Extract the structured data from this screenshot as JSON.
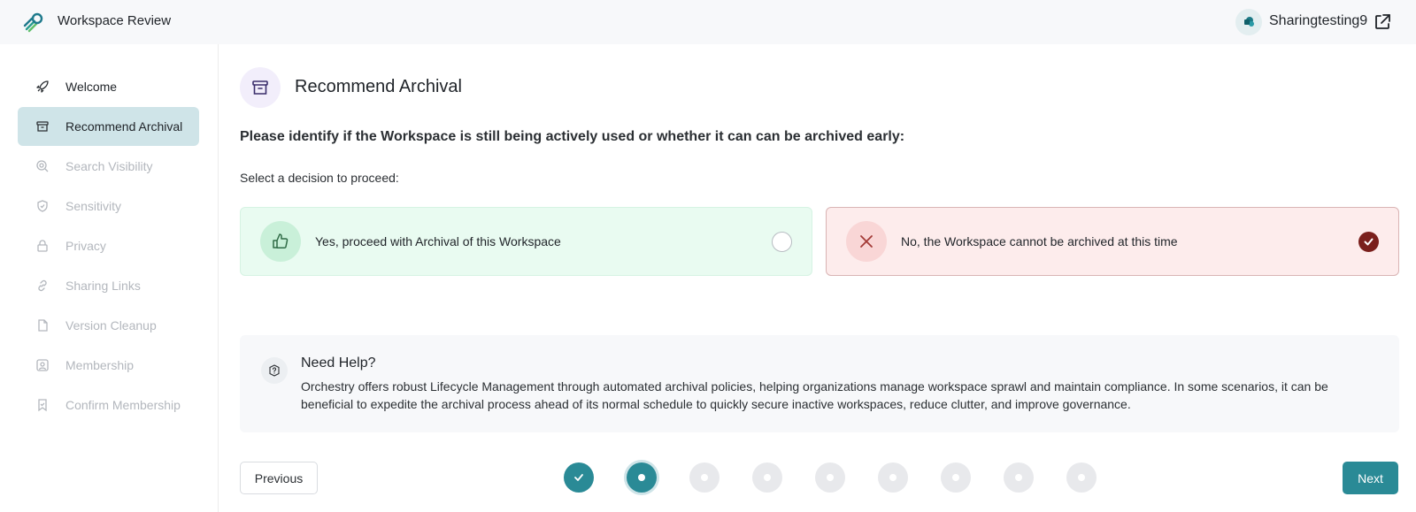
{
  "header": {
    "app_title": "Workspace Review",
    "user_name": "Sharingtesting9"
  },
  "sidebar": {
    "items": [
      {
        "label": "Welcome",
        "icon": "rocket-icon",
        "state": "done"
      },
      {
        "label": "Recommend Archival",
        "icon": "archive-icon",
        "state": "active"
      },
      {
        "label": "Search Visibility",
        "icon": "search-visibility-icon",
        "state": "pending"
      },
      {
        "label": "Sensitivity",
        "icon": "shield-icon",
        "state": "pending"
      },
      {
        "label": "Privacy",
        "icon": "lock-icon",
        "state": "pending"
      },
      {
        "label": "Sharing Links",
        "icon": "link-icon",
        "state": "pending"
      },
      {
        "label": "Version Cleanup",
        "icon": "document-icon",
        "state": "pending"
      },
      {
        "label": "Membership",
        "icon": "person-icon",
        "state": "pending"
      },
      {
        "label": "Confirm Membership",
        "icon": "bookmark-check-icon",
        "state": "pending"
      }
    ]
  },
  "main": {
    "section_title": "Recommend Archival",
    "question": "Please identify if the Workspace is still being actively used or whether it can can be archived early:",
    "select_prompt": "Select a decision to proceed:",
    "options": [
      {
        "label": "Yes, proceed with Archival of this Workspace",
        "icon": "thumbs-up-icon",
        "selected": false,
        "color": "#e9fbf1"
      },
      {
        "label": "No, the Workspace cannot be archived at this time",
        "icon": "x-icon",
        "selected": true,
        "color": "#fdecec"
      }
    ],
    "help": {
      "title": "Need Help?",
      "body": "Orchestry offers robust Lifecycle Management through automated archival policies, helping organizations manage workspace sprawl and maintain compliance. In some scenarios, it can be beneficial to expedite the archival process ahead of its normal schedule to quickly secure inactive workspaces, reduce clutter, and improve governance."
    }
  },
  "footer": {
    "previous_label": "Previous",
    "next_label": "Next",
    "steps": [
      "done",
      "current",
      "pending",
      "pending",
      "pending",
      "pending",
      "pending",
      "pending",
      "pending"
    ]
  },
  "colors": {
    "accent": "#2a8a96",
    "active_nav": "#cfe4e8",
    "selected_radio": "#7a1f1c"
  }
}
